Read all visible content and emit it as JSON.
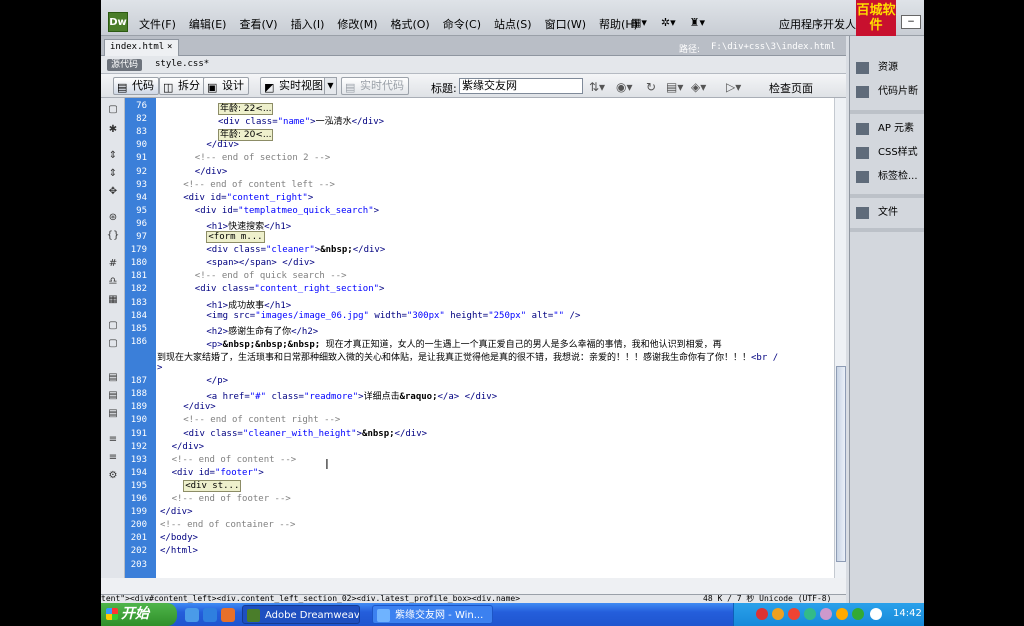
{
  "menubar": {
    "logo": "Dw",
    "menus": [
      "文件(F)",
      "编辑(E)",
      "查看(V)",
      "插入(I)",
      "修改(M)",
      "格式(O)",
      "命令(C)",
      "站点(S)",
      "窗口(W)",
      "帮助(H)"
    ],
    "workspace": "应用程序开发人员",
    "brand_logo": "百城软件",
    "tool_icons": [
      "layout-icon",
      "gear-icon",
      "site-icon"
    ]
  },
  "document": {
    "tab_label": "index.html",
    "tab_close": "×",
    "path_label": "路径:",
    "path_value": "F:\\div+css\\3\\index.html",
    "source_code_label": "源代码",
    "related_file": "style.css*"
  },
  "toolbar": {
    "code_label": "代码",
    "split_label": "拆分",
    "design_label": "设计",
    "live_view_label": "实时视图",
    "live_code_label": "实时代码",
    "title_label": "标题:",
    "title_value": "紫缘交友网",
    "check_page_label": "检查页面"
  },
  "editor": {
    "lines": [
      {
        "n": "76",
        "html": "<span class='collapsed txt'>年龄: 22&lt;...</span>",
        "indent": 5
      },
      {
        "n": "82",
        "html": "<span class='tag'>&lt;div</span> <span class='at'>class=</span><span class='val'>\"name\"</span><span class='tag'>&gt;</span><span class='txt'>一泓清水</span><span class='tag'>&lt;/div&gt;</span>",
        "indent": 5
      },
      {
        "n": "83",
        "html": "<span class='collapsed txt'>年龄: 20&lt;...</span>",
        "indent": 5
      },
      {
        "n": "90",
        "html": "<span class='tag'>&lt;/div&gt;</span>",
        "indent": 4
      },
      {
        "n": "91",
        "html": "<span class='cm'>&lt;!-- end of section 2 --&gt;</span>",
        "indent": 3
      },
      {
        "n": "92",
        "html": "<span class='tag'>&lt;/div&gt;</span>",
        "indent": 3
      },
      {
        "n": "93",
        "html": "<span class='cm'>&lt;!-- end of content left --&gt;</span>",
        "indent": 2
      },
      {
        "n": "94",
        "html": "<span class='tag'>&lt;div</span> <span class='at'>id=</span><span class='val'>\"content_right\"</span><span class='tag'>&gt;</span>",
        "indent": 2
      },
      {
        "n": "95",
        "html": "<span class='tag'>&lt;div</span> <span class='at'>id=</span><span class='val'>\"templatmeo_quick_search\"</span><span class='tag'>&gt;</span>",
        "indent": 3
      },
      {
        "n": "96",
        "html": "<span class='tag'>&lt;h1&gt;</span><span class='txt'>快速搜索</span><span class='tag'>&lt;/h1&gt;</span>",
        "indent": 4
      },
      {
        "n": "97",
        "html": "<span class='collapsed'>&lt;form m...</span>",
        "indent": 4
      },
      {
        "n": "179",
        "html": "<span class='tag'>&lt;div</span> <span class='at'>class=</span><span class='val'>\"cleaner\"</span><span class='tag'>&gt;</span><span class='ent'>&amp;nbsp;</span><span class='tag'>&lt;/div&gt;</span>",
        "indent": 4
      },
      {
        "n": "180",
        "html": "<span class='tag'>&lt;span&gt;&lt;/span&gt; &lt;/div&gt;</span>",
        "indent": 4
      },
      {
        "n": "181",
        "html": "<span class='cm'>&lt;!-- end of quick search --&gt;</span>",
        "indent": 3
      },
      {
        "n": "182",
        "html": "<span class='tag'>&lt;div</span> <span class='at'>class=</span><span class='val'>\"content_right_section\"</span><span class='tag'>&gt;</span>",
        "indent": 3
      },
      {
        "n": "183",
        "html": "<span class='tag'>&lt;h1&gt;</span><span class='txt'>成功故事</span><span class='tag'>&lt;/h1&gt;</span>",
        "indent": 4
      },
      {
        "n": "184",
        "html": "<span class='tag'>&lt;img</span> <span class='at'>src=</span><span class='val'>\"images/image_06.jpg\"</span> <span class='at'>width=</span><span class='val'>\"300px\"</span> <span class='at'>height=</span><span class='val'>\"250px\"</span> <span class='at'>alt=</span><span class='val'>\"\"</span> <span class='tag'>/&gt;</span>",
        "indent": 4
      },
      {
        "n": "185",
        "html": "<span class='tag'>&lt;h2&gt;</span><span class='txt'>感谢生命有了你</span><span class='tag'>&lt;/h2&gt;</span>",
        "indent": 4
      },
      {
        "n": "186",
        "html": "<span class='tag'>&lt;p&gt;</span><span class='ent'>&amp;nbsp;&amp;nbsp;&amp;nbsp;</span> <span class='txt'>现在才真正知道，女人的一生遇上一个真正爱自己的男人是多么幸福的事情，我和他认识到相爱，再</span>",
        "indent": 4
      },
      {
        "n": "",
        "html": "<span class='txt'>到现在大家结婚了，生活琐事和日常那种细致入微的关心和体贴，是让我真正觉得他是真的很不错，我想说：亲爱的！！！感谢我生命你有了你！！！</span><span class='tag'>&lt;br /</span>",
        "indent": 0
      },
      {
        "n": "",
        "html": "<span class='tag'>&gt;</span>",
        "indent": 0
      },
      {
        "n": "187",
        "html": "<span class='tag'>&lt;/p&gt;</span>",
        "indent": 4
      },
      {
        "n": "188",
        "html": "<span class='tag'>&lt;a</span> <span class='at'>href=</span><span class='val'>\"#\"</span> <span class='at'>class=</span><span class='val'>\"readmore\"</span><span class='tag'>&gt;</span><span class='txt'>详细点击</span><span class='ent'>&amp;raquo;</span><span class='tag'>&lt;/a&gt; &lt;/div&gt;</span>",
        "indent": 4
      },
      {
        "n": "189",
        "html": "<span class='tag'>&lt;/div&gt;</span>",
        "indent": 2
      },
      {
        "n": "190",
        "html": "<span class='cm'>&lt;!-- end of content right --&gt;</span>",
        "indent": 2
      },
      {
        "n": "191",
        "html": "<span class='tag'>&lt;div</span> <span class='at'>class=</span><span class='val'>\"cleaner_with_height\"</span><span class='tag'>&gt;</span><span class='ent'>&amp;nbsp;</span><span class='tag'>&lt;/div&gt;</span>",
        "indent": 2
      },
      {
        "n": "192",
        "html": "<span class='tag'>&lt;/div&gt;</span>",
        "indent": 1
      },
      {
        "n": "193",
        "html": "<span class='cm'>&lt;!-- end of content --&gt;</span>",
        "indent": 1
      },
      {
        "n": "194",
        "html": "<span class='tag'>&lt;div</span> <span class='at'>id=</span><span class='val'>\"footer\"</span><span class='tag'>&gt;</span>",
        "indent": 1
      },
      {
        "n": "195",
        "html": "<span class='collapsed'>&lt;div st...</span>",
        "indent": 2
      },
      {
        "n": "196",
        "html": "<span class='cm'>&lt;!-- end of footer --&gt;</span>",
        "indent": 1
      },
      {
        "n": "199",
        "html": "<span class='tag'>&lt;/div&gt;</span>",
        "indent": 0
      },
      {
        "n": "200",
        "html": "<span class='cm'>&lt;!-- end of container --&gt;</span>",
        "indent": 0
      },
      {
        "n": "201",
        "html": "<span class='tag'>&lt;/body&gt;</span>",
        "indent": 0
      },
      {
        "n": "202",
        "html": "<span class='tag'>&lt;/html&gt;</span>",
        "indent": 0
      },
      {
        "n": "203",
        "html": "",
        "indent": 0
      }
    ]
  },
  "statusbar": {
    "tag_selector": "tent\">&lt;div#content_left&gt;&lt;div.content_left_section_02&gt;&lt;div.latest_profile_box&gt;&lt;div.name&gt;",
    "file_info": "48 K / 7 秒  Unicode (UTF-8)"
  },
  "right_panel": {
    "items": [
      "资源",
      "代码片断",
      "AP 元素",
      "CSS样式",
      "标签检...",
      "文件"
    ]
  },
  "taskbar": {
    "start_label": "开始",
    "tasks": [
      "Adobe Dreamweave...",
      "紫缘交友网 - Win..."
    ],
    "clock": "14:42"
  },
  "colors": {
    "gutter": "#3b7fd9",
    "taskbar": "#245edb",
    "start": "#2f8f2a"
  }
}
